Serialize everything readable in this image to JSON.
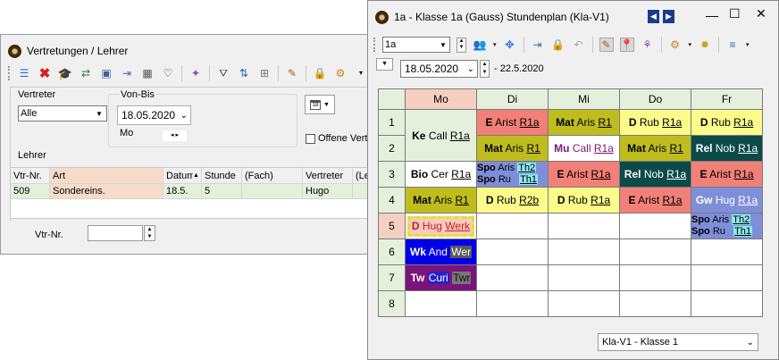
{
  "left": {
    "title": "Vertretungen / Lehrer",
    "vertreter_label": "Vertreter",
    "vertreter_value": "Alle",
    "vonbis_label": "Von-Bis",
    "date": "18.05.2020",
    "day": "Mo",
    "offene": "Offene Vertr",
    "lehrer": "Lehrer",
    "columns": [
      "Vtr-Nr.",
      "Art",
      "Datum",
      "Stunde",
      "(Fach)",
      "Vertreter",
      "(Le"
    ],
    "row": [
      "509",
      "Sondereins.",
      "18.5.",
      "5",
      "",
      "Hugo"
    ],
    "vtrnr_label": "Vtr-Nr."
  },
  "right": {
    "title": "1a - Klasse 1a (Gauss)  Stundenplan  (Kla-V1)",
    "class_select": "1a",
    "date": "18.05.2020",
    "date_end": "- 22.5.2020",
    "footer_select": "Kla-V1 - Klasse 1",
    "days": [
      "Mo",
      "Di",
      "Mi",
      "Do",
      "Fr"
    ],
    "periods": [
      "1",
      "2",
      "3",
      "4",
      "5",
      "6",
      "7",
      "8"
    ]
  },
  "colors": {
    "salmon": "#f28078",
    "olive": "#bfbd1e",
    "yellow": "#fbfb8a",
    "teal": "#0c4a49",
    "blue_lav": "#7f8ed9",
    "blue": "#0000e6",
    "purple": "#7a147a"
  }
}
